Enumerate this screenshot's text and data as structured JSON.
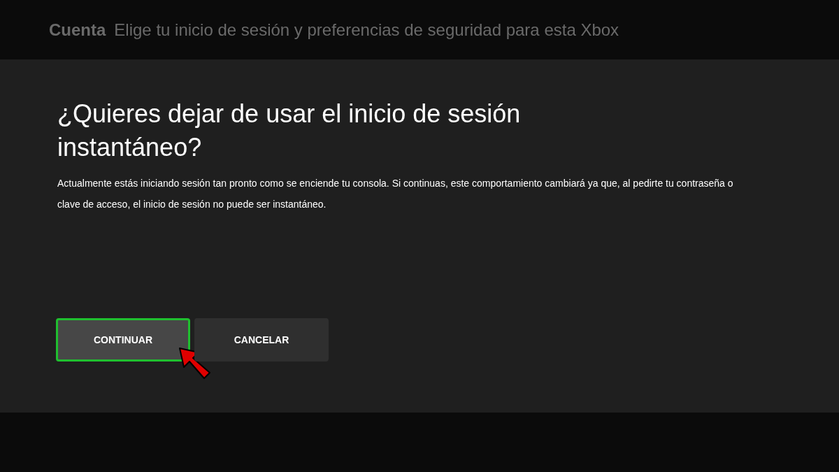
{
  "header": {
    "section": "Cuenta",
    "subtitle": "Elige tu inicio de sesión y preferencias de seguridad para esta Xbox"
  },
  "dialog": {
    "title": "¿Quieres dejar de usar el inicio de sesión instantáneo?",
    "message": "Actualmente estás iniciando sesión tan pronto como se enciende tu consola. Si continuas, este comportamiento cambiará ya que, al pedirte tu contraseña o clave de acceso, el inicio de sesión no puede ser instantáneo.",
    "buttons": [
      {
        "label": "CONTINUAR",
        "selected": true
      },
      {
        "label": "CANCELAR",
        "selected": false
      }
    ]
  }
}
